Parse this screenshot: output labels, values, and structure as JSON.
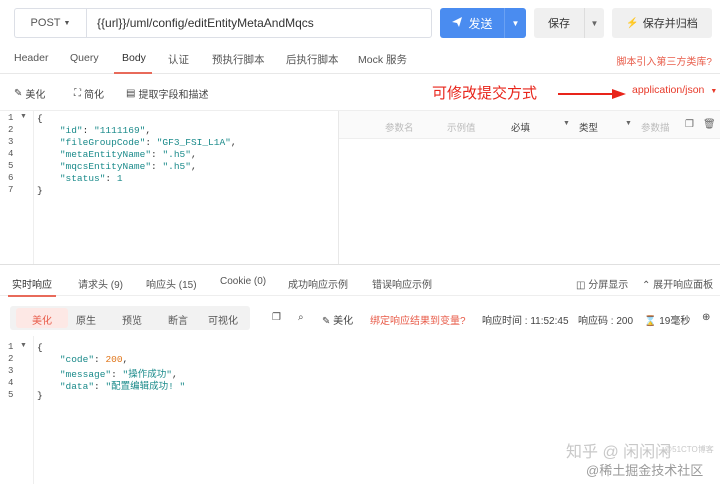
{
  "request": {
    "method": "POST",
    "url": "{{url}}/uml/config/editEntityMetaAndMqcs",
    "send_label": "发送",
    "save_label": "保存",
    "save_archive_label": "保存并归档"
  },
  "tabs": [
    "Header",
    "Query",
    "Body",
    "认证",
    "预执行脚本",
    "后执行脚本",
    "Mock 服务"
  ],
  "script_link": "脚本引入第三方类库?",
  "body_toolbar": {
    "beautify": "美化",
    "simplify": "简化",
    "extract": "提取字段和描述",
    "annotation": "可修改提交方式",
    "content_type": "application/json"
  },
  "request_body_lines": [
    "1",
    "2",
    "3",
    "4",
    "5",
    "6",
    "7"
  ],
  "request_body": {
    "id_key": "\"id\"",
    "id_val": "\"1111169\"",
    "fgc_key": "\"fileGroupCode\"",
    "fgc_val": "\"GF3_FSI_L1A\"",
    "meta_key": "\"metaEntityName\"",
    "meta_val": "\".h5\"",
    "mqcs_key": "\"mqcsEntityName\"",
    "mqcs_val": "\".h5\"",
    "status_key": "\"status\"",
    "status_val": "1"
  },
  "params_header": {
    "name": "参数名",
    "example": "示例值",
    "required": "必填",
    "type": "类型",
    "desc": "参数描"
  },
  "response_tabs": [
    "实时响应",
    "请求头 (9)",
    "响应头 (15)",
    "Cookie (0)",
    "成功响应示例",
    "错误响应示例"
  ],
  "response_right": {
    "split": "分屏显示",
    "expand": "展开响应面板"
  },
  "response_view": [
    "美化",
    "原生",
    "预览",
    "断言",
    "可视化"
  ],
  "response_toolbar": {
    "beautify": "美化",
    "bind": "绑定响应结果到变量?",
    "time": "响应时间 : 11:52:45",
    "code": "响应码 : 200",
    "duration": "19毫秒"
  },
  "response_lines": [
    "1",
    "2",
    "3",
    "4",
    "5"
  ],
  "response_body": {
    "code_key": "\"code\"",
    "code_val": "200",
    "msg_key": "\"message\"",
    "msg_val": "\"操作成功\"",
    "data_key": "\"data\"",
    "data_val": "\"配置编辑成功! \""
  },
  "watermarks": {
    "zhihu": "知乎 @ 闲闲闲",
    "juejin": "@稀土掘金技术社区",
    "csdn": "@51CTO博客"
  }
}
